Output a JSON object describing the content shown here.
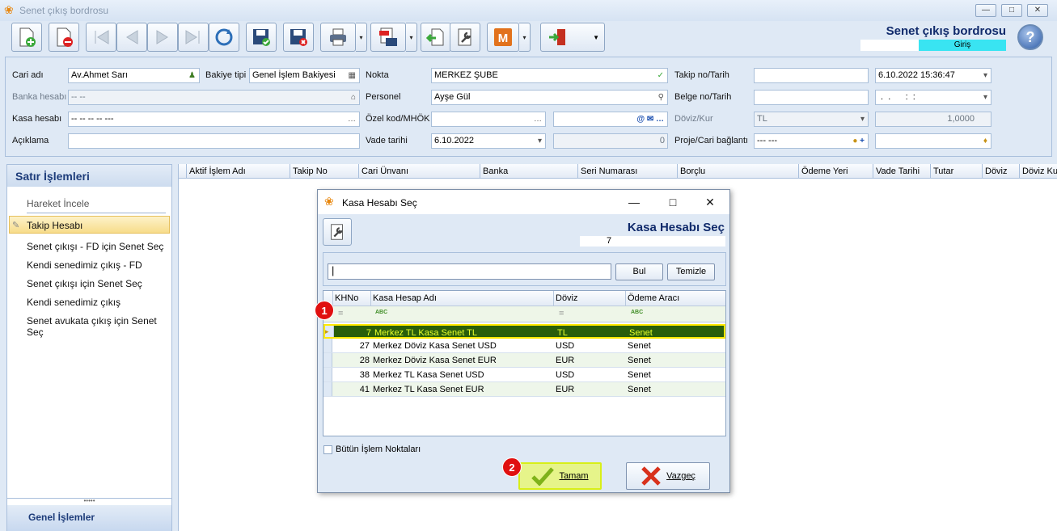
{
  "app": {
    "title": "Senet çıkış bordrosu"
  },
  "header": {
    "form_title": "Senet çıkış bordrosu",
    "status": "Giriş"
  },
  "form": {
    "cari_adi": {
      "label": "Cari adı",
      "value": "Av.Ahmet Sarı"
    },
    "bakiye_tipi": {
      "label": "Bakiye tipi",
      "value": "Genel İşlem Bakiyesi"
    },
    "nokta": {
      "label": "Nokta",
      "value": "MERKEZ ŞUBE"
    },
    "takip_no": {
      "label": "Takip no/Tarih",
      "value": "",
      "date": "6.10.2022 15:36:47"
    },
    "banka_hesabi": {
      "label": "Banka hesabı",
      "value": "-- --"
    },
    "personel": {
      "label": "Personel",
      "value": "Ayşe Gül"
    },
    "belge_no": {
      "label": "Belge no/Tarih",
      "value": "",
      "date": " .  .      :  :"
    },
    "kasa_hesabi": {
      "label": "Kasa hesabı",
      "value": "-- -- -- -- ---"
    },
    "ozel_kod": {
      "label": "Özel kod/MHÖK",
      "value": ""
    },
    "doviz_kur": {
      "label": "Döviz/Kur",
      "currency": "TL",
      "rate": "1,0000"
    },
    "aciklama": {
      "label": "Açıklama",
      "value": ""
    },
    "vade_tarihi": {
      "label": "Vade tarihi",
      "value": "6.10.2022",
      "amount": "0"
    },
    "proje": {
      "label": "Proje/Cari bağlantı",
      "value": "--- ---"
    }
  },
  "left_panel": {
    "header": "Satır İşlemleri",
    "items": [
      "Hareket İncele",
      "Takip Hesabı",
      "Senet çıkışı - FD için Senet Seç",
      "Kendi senedimiz çıkış - FD",
      "Senet çıkışı için Senet Seç",
      "Kendi senedimiz çıkış",
      "Senet avukata çıkış için Senet Seç"
    ],
    "footer": "Genel İşlemler"
  },
  "main_grid": {
    "columns": [
      "Aktif İşlem Adı",
      "Takip No",
      "Cari Ünvanı",
      "Banka",
      "Seri Numarası",
      "Borçlu",
      "Ödeme Yeri",
      "Vade Tarihi",
      "Tutar",
      "Döviz",
      "Döviz Kur"
    ]
  },
  "dialog": {
    "title": "Kasa Hesabı Seç",
    "heading": "Kasa Hesabı Seç",
    "count": "7",
    "search_value": "",
    "find_label": "Bul",
    "clear_label": "Temizle",
    "columns": [
      "KHNo",
      "Kasa Hesap Adı",
      "Döviz",
      "Ödeme Aracı"
    ],
    "filter": {
      "eq1": "=",
      "abc1": "ABC",
      "eq2": "=",
      "abc2": "ABC"
    },
    "rows": [
      {
        "no": "7",
        "name": "Merkez TL Kasa Senet TL",
        "currency": "TL",
        "method": "Senet"
      },
      {
        "no": "27",
        "name": "Merkez Döviz Kasa Senet USD",
        "currency": "USD",
        "method": "Senet"
      },
      {
        "no": "28",
        "name": "Merkez Döviz Kasa Senet EUR",
        "currency": "EUR",
        "method": "Senet"
      },
      {
        "no": "38",
        "name": "Merkez TL Kasa Senet USD",
        "currency": "USD",
        "method": "Senet"
      },
      {
        "no": "41",
        "name": "Merkez TL Kasa Senet EUR",
        "currency": "EUR",
        "method": "Senet"
      }
    ],
    "all_points_label": "Bütün İşlem Noktaları",
    "ok_label": "Tamam",
    "cancel_label": "Vazgeç"
  },
  "callouts": {
    "one": "1",
    "two": "2"
  },
  "colors": {
    "selected_row": "#295e0a",
    "selected_text": "#e8ff2a",
    "highlight": "#e6f48a",
    "callout": "#e01010"
  }
}
